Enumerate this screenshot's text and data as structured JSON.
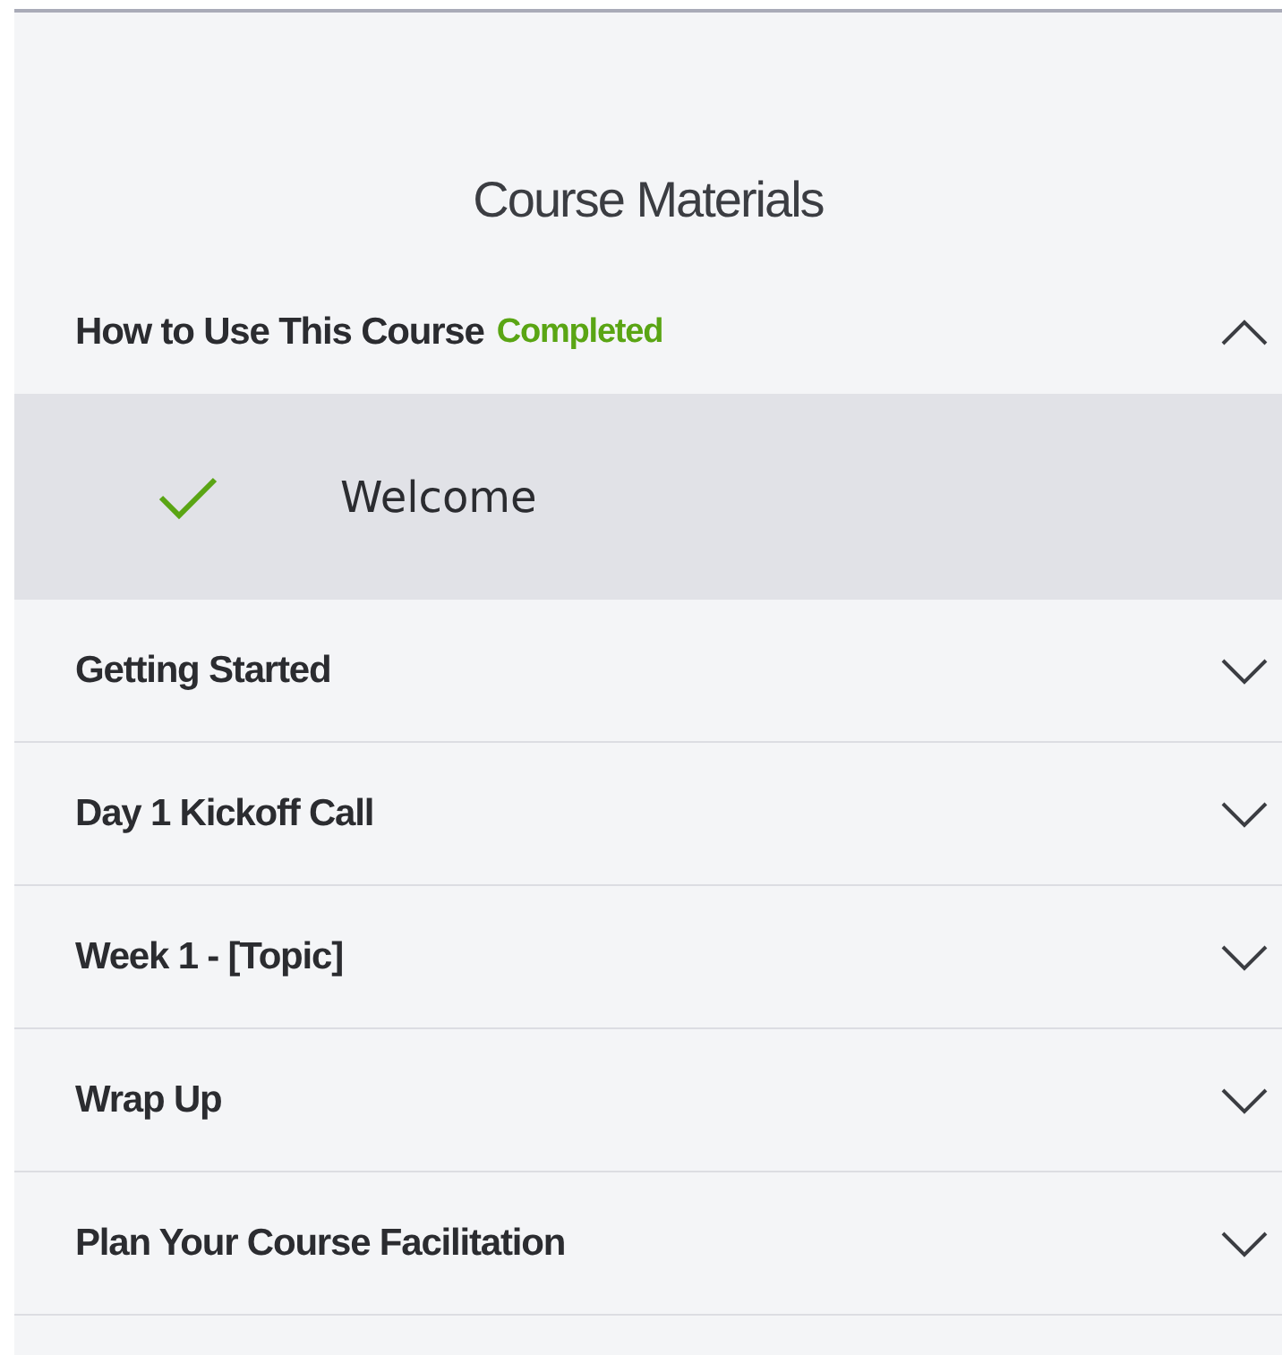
{
  "title": "Course Materials",
  "sections": [
    {
      "label": "How to Use This Course",
      "status": "Completed",
      "expanded": true,
      "lessons": [
        {
          "label": "Welcome",
          "completed": true,
          "selected": true
        }
      ]
    },
    {
      "label": "Getting Started",
      "expanded": false
    },
    {
      "label": "Day 1 Kickoff Call",
      "expanded": false
    },
    {
      "label": "Week 1 - [Topic]",
      "expanded": false
    },
    {
      "label": "Wrap Up",
      "expanded": false
    },
    {
      "label": "Plan Your Course Facilitation",
      "expanded": false
    }
  ]
}
